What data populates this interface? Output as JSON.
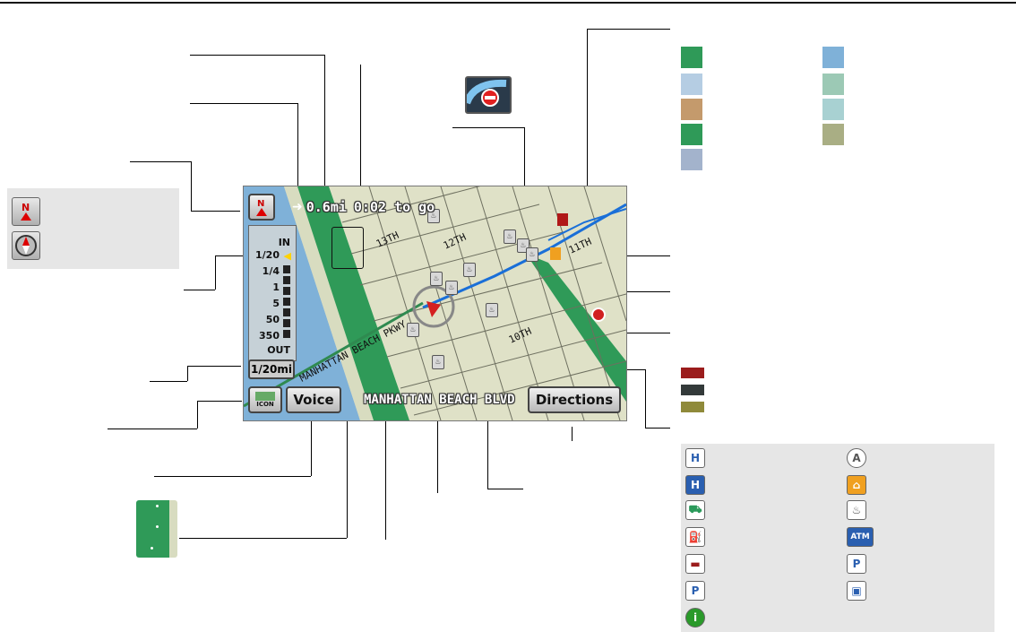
{
  "map_screen": {
    "distance": "0.6mi",
    "time_to_go": "0:02 to go",
    "street_name": "MANHATTAN BEACH BLVD",
    "voice_label": "Voice",
    "directions_label": "Directions",
    "icon_label": "ICON",
    "scale_readout": "1/20mi",
    "zoom_in_label": "IN",
    "zoom_out_label": "OUT",
    "scale_levels": [
      "1/20",
      "1/4",
      "1",
      "5",
      "50",
      "350"
    ],
    "selected_scale": "1/20",
    "street_labels": [
      "13TH",
      "12TH",
      "11TH",
      "10TH",
      "MANHATTAN BEACH PKWY"
    ]
  },
  "colors": {
    "water": "#7fb1d8",
    "park": "#2f9a58",
    "land": "#dfe1c7",
    "route": "#1a6fd8",
    "street_red": "#9b1c1c",
    "street_dark": "#333a3a",
    "street_olive": "#8f8a3a"
  },
  "icons": {
    "heading_up": "north-up-icon",
    "compass": "compass-icon",
    "list": [
      "honda-dealer-icon",
      "acura-dealer-icon",
      "hospital-icon",
      "school-icon",
      "shopping-icon",
      "restaurant-icon",
      "gas-station-icon",
      "atm-icon",
      "hotel-icon",
      "parking-lot-icon",
      "parking-garage-icon",
      "train-station-icon",
      "information-icon"
    ],
    "atm_text": "ATM"
  }
}
